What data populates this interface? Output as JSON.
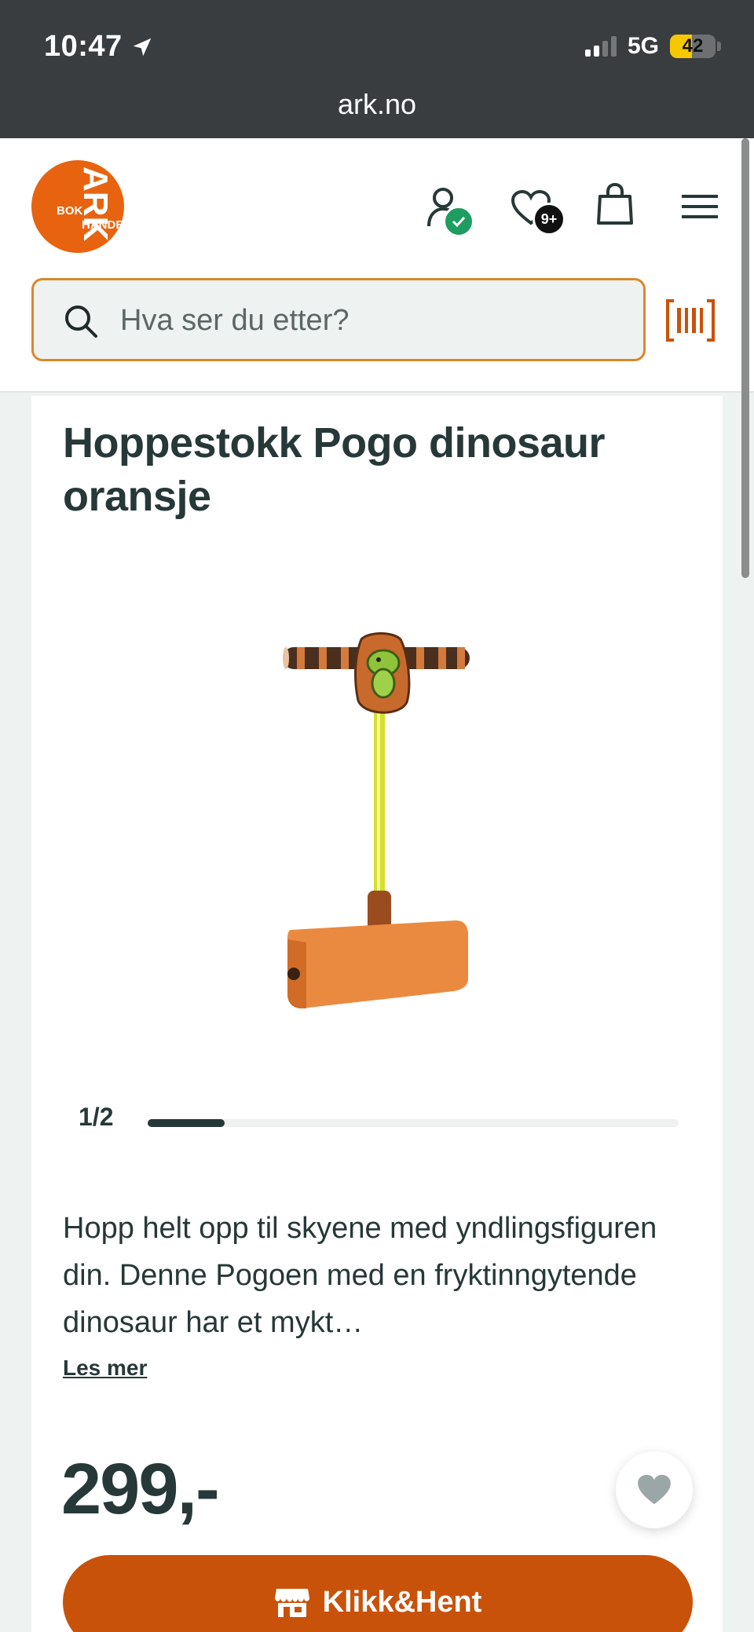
{
  "status_bar": {
    "time": "10:47",
    "network": "5G",
    "battery": "42",
    "url": "ark.no"
  },
  "header": {
    "logo_text_big": "ARK",
    "logo_text_small_1": "BOK",
    "logo_text_small_2": "HANDEL",
    "wishlist_count": "9+",
    "brand_color": "#e8630f"
  },
  "search": {
    "placeholder": "Hva ser du etter?"
  },
  "product": {
    "title": "Hoppestokk Pogo dinosaur oransje",
    "image_index": "1/2",
    "description": "Hopp helt opp til skyene med yndlingsfiguren din. Denne Pogoen med en fryktinngytende dinosaur har et mykt…",
    "read_more": "Les mer",
    "price": "299,-",
    "cta_label": "Klikk&Hent",
    "cta_color": "#c9520a"
  }
}
